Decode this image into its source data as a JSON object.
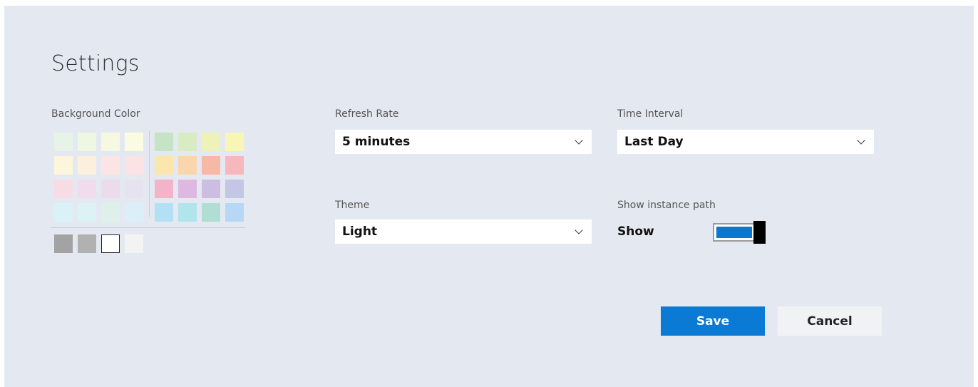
{
  "title": "Settings",
  "background_color": {
    "label": "Background Color",
    "left_swatches": [
      "#e6f3e6",
      "#eef6e4",
      "#f7f8e2",
      "#fbfbe1",
      "#fdf6dc",
      "#fcf0dc",
      "#fbe4e3",
      "#fbe2e4",
      "#f8dce5",
      "#f0dcec",
      "#ebdcec",
      "#e6e2ef",
      "#daf1fa",
      "#dcf2f5",
      "#dff0ea",
      "#dceef7"
    ],
    "right_swatches": [
      "#c5e4c5",
      "#d9ebc3",
      "#eef2b8",
      "#f8f5b5",
      "#fbe6ad",
      "#fbd5ac",
      "#f7b9a6",
      "#f7b8bd",
      "#f3b4c9",
      "#deb8e1",
      "#cdbde3",
      "#c3c7e6",
      "#b4e0f6",
      "#b0e5ec",
      "#b1ded2",
      "#b6d8f5"
    ],
    "bottom_swatches": [
      "#a3a3a3",
      "#b1b1b1",
      "#ffffff",
      "#f3f3f3"
    ]
  },
  "refresh_rate": {
    "label": "Refresh Rate",
    "value": "5 minutes"
  },
  "time_interval": {
    "label": "Time Interval",
    "value": "Last Day"
  },
  "theme": {
    "label": "Theme",
    "value": "Light"
  },
  "instance_path": {
    "label": "Show instance path",
    "value": "Show",
    "on": true
  },
  "buttons": {
    "save": "Save",
    "cancel": "Cancel"
  },
  "colors": {
    "accent": "#0a7ad4",
    "panel": "#e4e9f1"
  }
}
